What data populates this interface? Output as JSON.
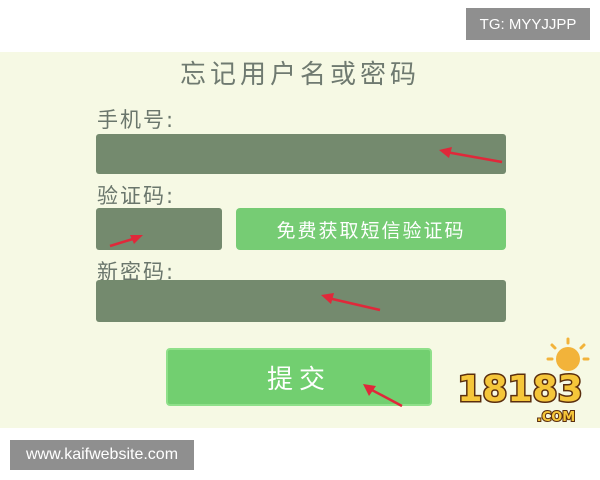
{
  "badge": {
    "text": "TG: MYYJJPP"
  },
  "form": {
    "title": "忘记用户名或密码",
    "phone_label": "手机号:",
    "code_label": "验证码:",
    "sms_button": "免费获取短信验证码",
    "new_password_label": "新密码:",
    "submit_button": "提交",
    "phone_value": "",
    "code_value": "",
    "new_password_value": ""
  },
  "logo": {
    "number_text": "18183",
    "domain_text": ".COM"
  },
  "watermark": {
    "text": "www.kaifwebsite.com"
  },
  "colors": {
    "panel_bg": "#f6f9e4",
    "field_bg": "#748a6e",
    "button_green": "#72cf70",
    "arrow_red": "#e0283a",
    "label_text": "#6a766c"
  }
}
